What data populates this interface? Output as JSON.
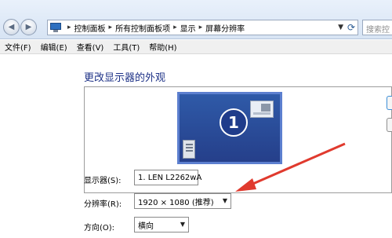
{
  "address_bar": {
    "breadcrumbs": [
      "控制面板",
      "所有控制面板项",
      "显示",
      "屏幕分辨率"
    ],
    "search_placeholder": "搜索控"
  },
  "menu": [
    "文件(F)",
    "编辑(E)",
    "查看(V)",
    "工具(T)",
    "帮助(H)"
  ],
  "main": {
    "title": "更改显示器的外观",
    "monitor_number": "1",
    "display": {
      "label": "显示器(S):",
      "value": "1. LEN L2262wA"
    },
    "resolution": {
      "label": "分辨率(R):",
      "value": "1920 × 1080 (推荐)"
    },
    "orientation": {
      "label": "方向(O):",
      "value": "横向"
    }
  },
  "colors": {
    "title_blue": "#1e3287",
    "monitor_blue": "#2f5aa8",
    "annotation_red": "#e03a2e"
  }
}
